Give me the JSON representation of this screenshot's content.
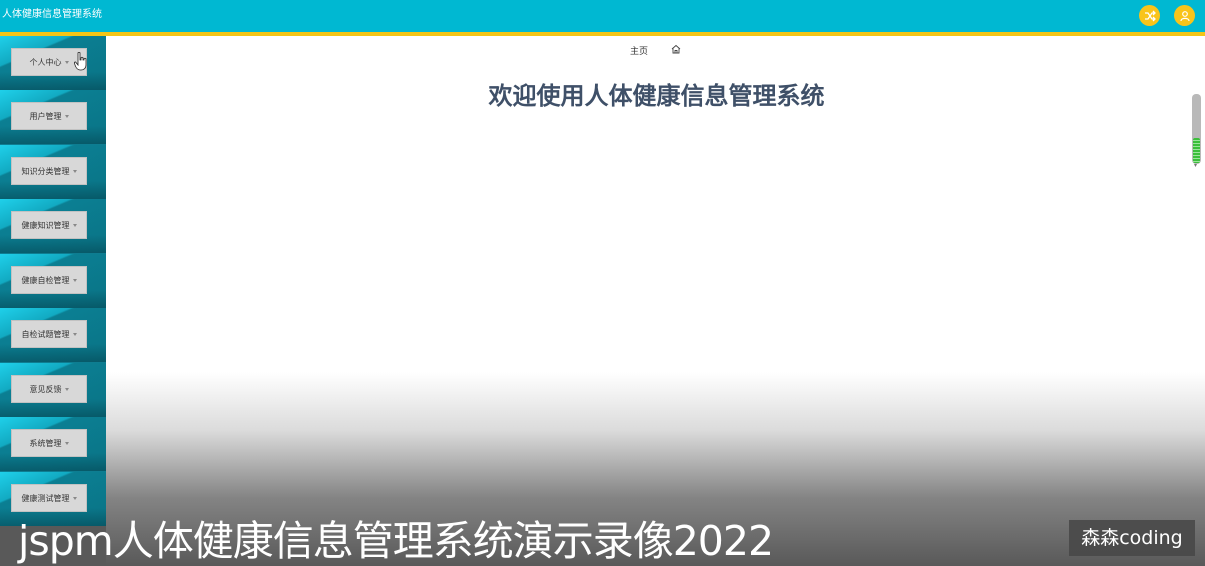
{
  "header": {
    "app_title": "人体健康信息管理系统",
    "icons": [
      "shuffle-icon",
      "user-icon"
    ],
    "accent_color": "#00b8d2",
    "strip_color": "#f4c516"
  },
  "sidebar": {
    "items": [
      {
        "label": "个人中心"
      },
      {
        "label": "用户管理"
      },
      {
        "label": "知识分类管理"
      },
      {
        "label": "健康知识管理"
      },
      {
        "label": "健康自检管理"
      },
      {
        "label": "自检试题管理"
      },
      {
        "label": "意见反馈"
      },
      {
        "label": "系统管理"
      },
      {
        "label": "健康测试管理"
      }
    ]
  },
  "main": {
    "breadcrumb": "主页",
    "title": "欢迎使用人体健康信息管理系统"
  },
  "overlay": {
    "caption": "jspm人体健康信息管理系统演示录像2022",
    "watermark": "森森coding"
  }
}
